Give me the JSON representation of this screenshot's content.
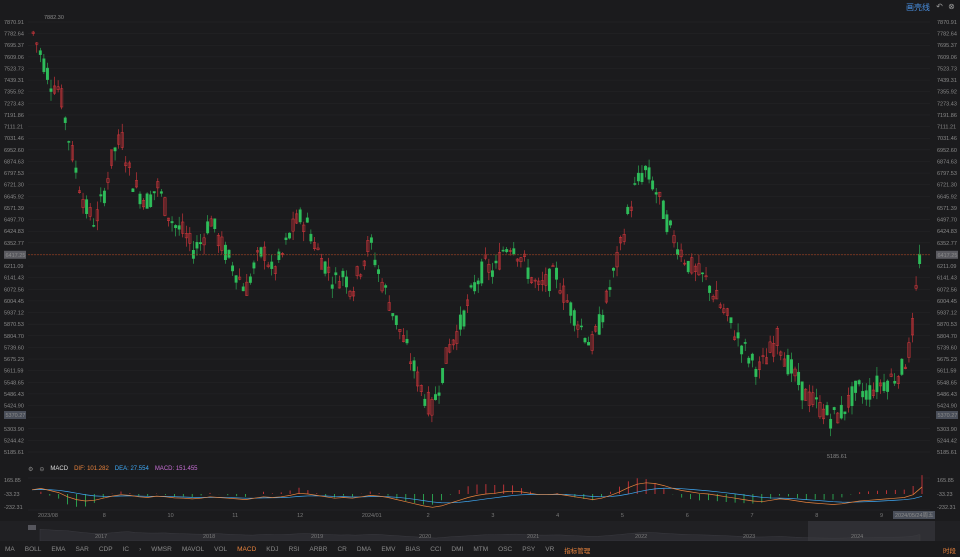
{
  "toolbar": {
    "link_label": "画壳线",
    "undo_icon": "undo-icon",
    "close_icon": "close-circle-icon"
  },
  "price_axis": {
    "ticks": [
      "7870.91",
      "7782.64",
      "7695.37",
      "7609.06",
      "7523.73",
      "7439.31",
      "7355.92",
      "7273.43",
      "7191.86",
      "7111.21",
      "7031.46",
      "6952.60",
      "6874.63",
      "6797.53",
      "6721.30",
      "6645.92",
      "6571.39",
      "6497.70",
      "6424.83",
      "6352.77",
      "6281.53",
      "6211.09",
      "6141.43",
      "6072.56",
      "6004.45",
      "5937.12",
      "5870.53",
      "5804.70",
      "5739.60",
      "5675.23",
      "5611.59",
      "5548.65",
      "5486.43",
      "5424.90",
      "5364.07",
      "5303.90",
      "5244.42",
      "5185.61"
    ],
    "current_price": "5370.27",
    "crosshair_price": "6417.25"
  },
  "annotations": {
    "high": "7882.30",
    "low": "5185.61"
  },
  "macd": {
    "name": "MACD",
    "dif": "DIF: 101.282",
    "dea": "DEA: 27.554",
    "macd": "MACD: 151.455",
    "axis": [
      "165.85",
      "-33.23",
      "-232.31"
    ],
    "colors": {
      "dif": "#e9833d",
      "dea": "#3fa9f5",
      "macd": "#c86fd6"
    }
  },
  "date_axis": {
    "labels": [
      "2023/08",
      "8",
      "10",
      "11",
      "12",
      "2024/01",
      "2",
      "3",
      "4",
      "5",
      "6",
      "7",
      "8",
      "9"
    ],
    "cursor_date": "2024/05/24周五"
  },
  "navigator": {
    "years": [
      "2017",
      "2018",
      "2019",
      "2020",
      "2021",
      "2022",
      "2023",
      "2024"
    ]
  },
  "indicators": {
    "tabs": [
      "MA",
      "BOLL",
      "EMA",
      "SAR",
      "CDP",
      "IC",
      "›",
      "WMSR",
      "MAVOL",
      "VOL",
      "MACD",
      "KDJ",
      "RSI",
      "ARBR",
      "CR",
      "DMA",
      "EMV",
      "BIAS",
      "CCI",
      "DMI",
      "MTM",
      "OSC",
      "PSY",
      "VR",
      "指标管理"
    ],
    "active": "MACD",
    "right_tab": "时段"
  },
  "chart_data": {
    "type": "candlestick",
    "ylim": [
      5185.61,
      7870.91
    ],
    "up_color": "#e0383e",
    "down_color": "#2ebd5a",
    "close_path": [
      7800,
      7650,
      7500,
      7450,
      7150,
      6900,
      6700,
      6620,
      6800,
      7050,
      7150,
      6900,
      6800,
      6750,
      6850,
      6700,
      6600,
      6550,
      6450,
      6500,
      6650,
      6500,
      6400,
      6300,
      6200,
      6350,
      6450,
      6300,
      6400,
      6550,
      6650,
      6600,
      6450,
      6350,
      6250,
      6300,
      6200,
      6350,
      6500,
      6300,
      6150,
      6000,
      5850,
      5700,
      5550,
      5450,
      5650,
      5850,
      5950,
      6100,
      6250,
      6350,
      6300,
      6450,
      6500,
      6400,
      6300,
      6200,
      6250,
      6300,
      6150,
      6050,
      5950,
      5850,
      6000,
      6200,
      6400,
      6650,
      6850,
      6950,
      6850,
      6700,
      6550,
      6450,
      6350,
      6300,
      6250,
      6150,
      6050,
      5950,
      5850,
      5750,
      5700,
      5800,
      5900,
      5750,
      5650,
      5550,
      5500,
      5450,
      5400,
      5420,
      5500,
      5580,
      5550,
      5600,
      5620,
      5650,
      5700,
      5850,
      6400
    ],
    "crosshair_price": 6417.25,
    "macd_series": {
      "dif": [
        60,
        80,
        50,
        20,
        -40,
        -80,
        -100,
        -90,
        -60,
        -30,
        -10,
        -20,
        -40,
        -50,
        -30,
        -40,
        -55,
        -60,
        -70,
        -60,
        -40,
        -50,
        -60,
        -70,
        -80,
        -60,
        -40,
        -50,
        -40,
        -20,
        10,
        0,
        -20,
        -40,
        -60,
        -50,
        -60,
        -40,
        -20,
        -30,
        -50,
        -80,
        -110,
        -140,
        -170,
        -190,
        -170,
        -130,
        -90,
        -50,
        -20,
        0,
        10,
        30,
        40,
        30,
        10,
        -10,
        -10,
        0,
        -20,
        -40,
        -60,
        -80,
        -60,
        -20,
        30,
        90,
        140,
        160,
        150,
        120,
        80,
        50,
        30,
        10,
        0,
        -20,
        -40,
        -60,
        -80,
        -100,
        -110,
        -90,
        -70,
        -80,
        -100,
        -120,
        -130,
        -140,
        -150,
        -140,
        -120,
        -100,
        -90,
        -80,
        -70,
        -60,
        -50,
        -10,
        101
      ]
    }
  }
}
